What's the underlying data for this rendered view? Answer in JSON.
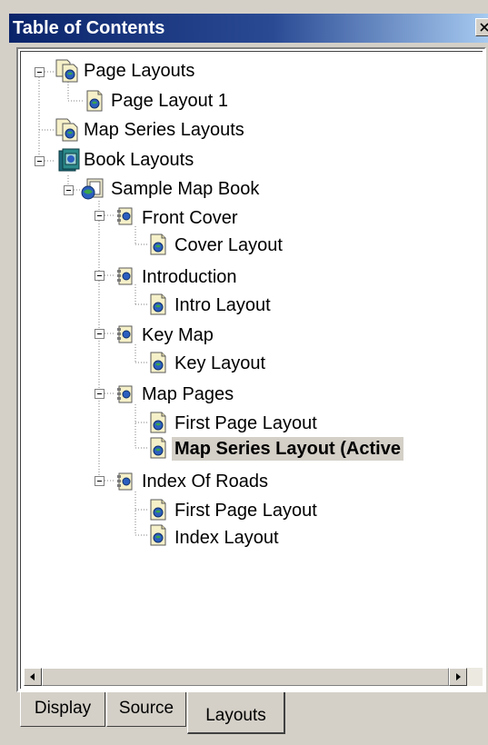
{
  "window": {
    "title": "Table of Contents"
  },
  "tree": {
    "page_layouts": "Page Layouts",
    "page_layout_1": "Page Layout 1",
    "map_series_layouts": "Map Series Layouts",
    "book_layouts": "Book Layouts",
    "sample_map_book": "Sample Map Book",
    "front_cover": "Front Cover",
    "cover_layout": "Cover Layout",
    "introduction": "Introduction",
    "intro_layout": "Intro Layout",
    "key_map": "Key Map",
    "key_layout": "Key Layout",
    "map_pages": "Map Pages",
    "first_page_layout_1": "First Page Layout",
    "map_series_layout_active": "Map Series Layout (Active",
    "index_of_roads": "Index Of Roads",
    "first_page_layout_2": "First Page Layout",
    "index_layout": "Index Layout"
  },
  "tabs": {
    "display": "Display",
    "source": "Source",
    "layouts": "Layouts"
  },
  "colors": {
    "titlebar": "#0a246a",
    "face": "#d4d0c8",
    "active_highlight": "#d4d0c8"
  },
  "icons": {
    "close": "close-icon",
    "page_layouts": "page-layouts-folder-icon",
    "layout": "layout-page-icon",
    "map_series": "map-series-icon",
    "book": "book-icon",
    "map_book": "map-book-icon",
    "section": "section-icon",
    "scroll_left": "scroll-left-arrow-icon",
    "scroll_right": "scroll-right-arrow-icon"
  }
}
